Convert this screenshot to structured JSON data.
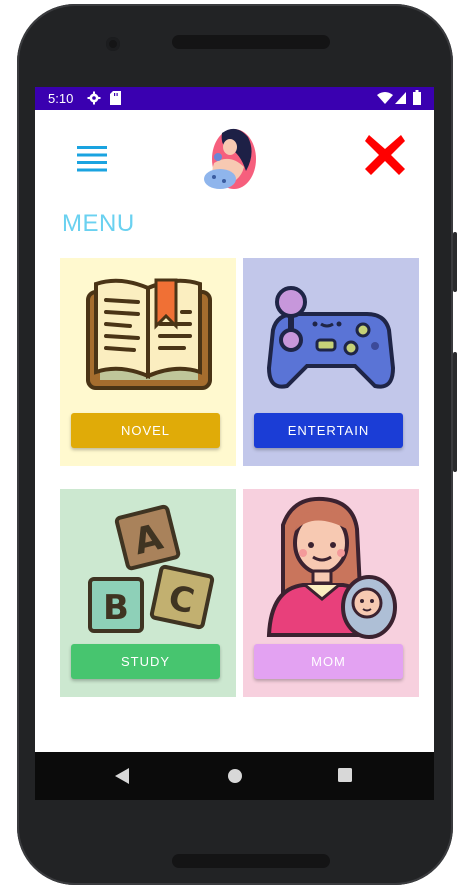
{
  "status_bar": {
    "time": "5:10"
  },
  "header": {
    "menu_icon": "hamburger-menu-icon",
    "logo_icon": "mother-and-child-logo",
    "close_icon": "close-x-icon"
  },
  "menu_title": "MENU",
  "tiles": [
    {
      "label": "NOVEL",
      "icon": "book-icon",
      "bg": "#fff9cf",
      "button_color": "#e0ab08"
    },
    {
      "label": "ENTERTAIN",
      "icon": "gamepad-icon",
      "bg": "#c2c7ea",
      "button_color": "#1b3dd6"
    },
    {
      "label": "STUDY",
      "icon": "abc-blocks-icon",
      "bg": "#cce8d0",
      "button_color": "#47c56f"
    },
    {
      "label": "MOM",
      "icon": "mother-with-baby-icon",
      "bg": "#f7d0de",
      "button_color": "#e3a2f2"
    }
  ],
  "colors": {
    "status_bar": "#3a00b0",
    "menu_title": "#6ad1f0",
    "hamburger": "#1aa3e0",
    "close": "#ff0000"
  },
  "nav_bar": {
    "back_icon": "back-triangle-icon",
    "home_icon": "home-circle-icon",
    "recents_icon": "recents-square-icon"
  }
}
